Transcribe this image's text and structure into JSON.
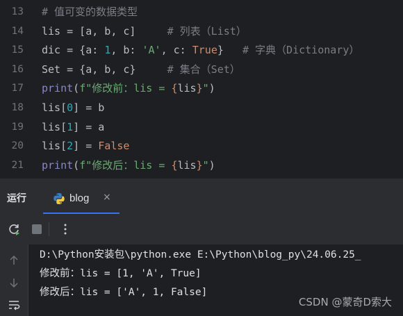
{
  "editor": {
    "lines": [
      {
        "num": "13",
        "segments": [
          {
            "t": "# 值可变的数据类型",
            "c": "comment"
          }
        ]
      },
      {
        "num": "14",
        "segments": [
          {
            "t": "lis = [a, b, c]     ",
            "c": "plain"
          },
          {
            "t": "# 列表（List）",
            "c": "comment"
          }
        ]
      },
      {
        "num": "15",
        "segments": [
          {
            "t": "dic = {a: ",
            "c": "plain"
          },
          {
            "t": "1",
            "c": "num"
          },
          {
            "t": ", b: ",
            "c": "plain"
          },
          {
            "t": "'A'",
            "c": "str"
          },
          {
            "t": ", c: ",
            "c": "plain"
          },
          {
            "t": "True",
            "c": "kw"
          },
          {
            "t": "}   ",
            "c": "plain"
          },
          {
            "t": "# 字典（Dictionary）",
            "c": "comment"
          }
        ]
      },
      {
        "num": "16",
        "segments": [
          {
            "t": "Set = {a, b, c}     ",
            "c": "plain"
          },
          {
            "t": "# 集合（Set）",
            "c": "comment"
          }
        ]
      },
      {
        "num": "17",
        "segments": [
          {
            "t": "print",
            "c": "builtin"
          },
          {
            "t": "(",
            "c": "plain"
          },
          {
            "t": "f\"修改前：lis = ",
            "c": "str"
          },
          {
            "t": "{",
            "c": "brace"
          },
          {
            "t": "lis",
            "c": "plain"
          },
          {
            "t": "}",
            "c": "brace"
          },
          {
            "t": "\"",
            "c": "str"
          },
          {
            "t": ")",
            "c": "plain"
          }
        ]
      },
      {
        "num": "18",
        "segments": [
          {
            "t": "lis[",
            "c": "plain"
          },
          {
            "t": "0",
            "c": "num"
          },
          {
            "t": "] = b",
            "c": "plain"
          }
        ]
      },
      {
        "num": "19",
        "segments": [
          {
            "t": "lis[",
            "c": "plain"
          },
          {
            "t": "1",
            "c": "num"
          },
          {
            "t": "] = a",
            "c": "plain"
          }
        ]
      },
      {
        "num": "20",
        "segments": [
          {
            "t": "lis[",
            "c": "plain"
          },
          {
            "t": "2",
            "c": "num"
          },
          {
            "t": "] = ",
            "c": "plain"
          },
          {
            "t": "False",
            "c": "kw"
          }
        ]
      },
      {
        "num": "21",
        "segments": [
          {
            "t": "print",
            "c": "builtin"
          },
          {
            "t": "(",
            "c": "plain"
          },
          {
            "t": "f\"修改后：lis = ",
            "c": "str"
          },
          {
            "t": "{",
            "c": "brace"
          },
          {
            "t": "lis",
            "c": "plain"
          },
          {
            "t": "}",
            "c": "brace"
          },
          {
            "t": "\"",
            "c": "str"
          },
          {
            "t": ")",
            "c": "plain"
          }
        ]
      }
    ]
  },
  "run_window": {
    "label": "运行",
    "tab_label": "blog",
    "tab_close": "×",
    "toolbar_icons": [
      "rerun-icon",
      "stop-icon",
      "more-options-icon"
    ],
    "side_icons": [
      "up-arrow-icon",
      "down-arrow-icon",
      "soft-wrap-icon"
    ]
  },
  "console": {
    "lines": [
      "D:\\Python安装包\\python.exe E:\\Python\\blog_py\\24.06.25_",
      "修改前：lis = [1, 'A', True]",
      "修改后：lis = ['A', 1, False]"
    ]
  },
  "watermark": "CSDN @蒙奇D索大",
  "colors": {
    "editor_bg": "#1e1f22",
    "panel_bg": "#2b2d30",
    "comment": "#7a7e85",
    "keyword": "#cf8e6d",
    "number": "#2aacb8",
    "string": "#6aab73",
    "builtin": "#8888c6",
    "accent": "#3574f0"
  }
}
